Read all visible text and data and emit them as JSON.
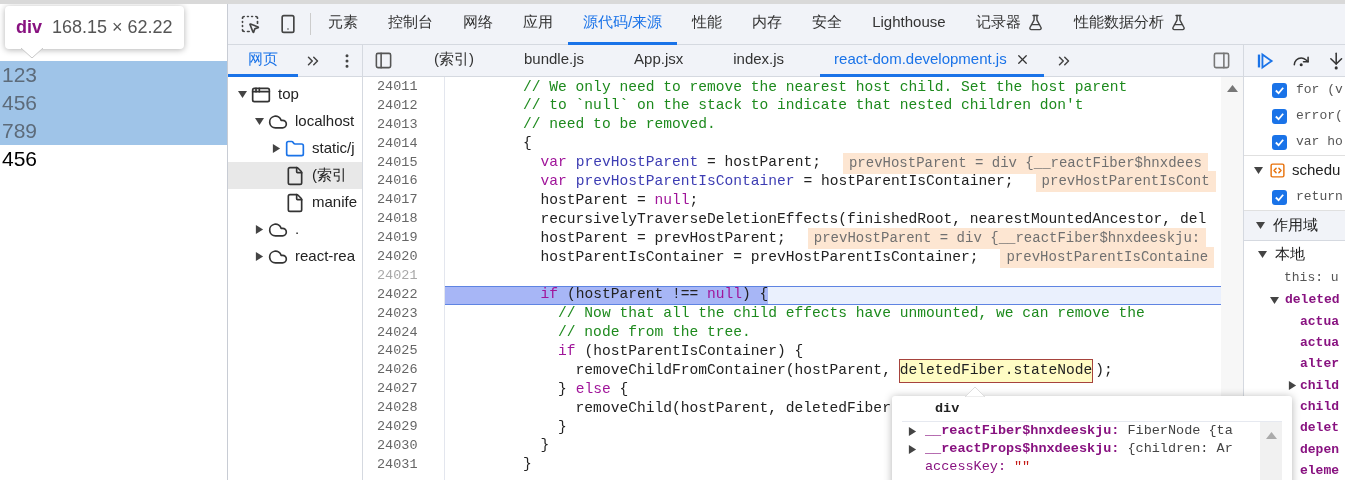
{
  "page": {
    "tooltip": {
      "tag": "div",
      "size": "168.15 × 62.22"
    },
    "lines": [
      {
        "text": "123",
        "highlighted": true
      },
      {
        "text": "456",
        "highlighted": true
      },
      {
        "text": "789",
        "highlighted": true
      },
      {
        "text": "456",
        "highlighted": false
      }
    ]
  },
  "devtools": {
    "tabs": [
      {
        "label": "元素",
        "selected": false,
        "experimental": false
      },
      {
        "label": "控制台",
        "selected": false,
        "experimental": false
      },
      {
        "label": "网络",
        "selected": false,
        "experimental": false
      },
      {
        "label": "应用",
        "selected": false,
        "experimental": false
      },
      {
        "label": "源代码/来源",
        "selected": true,
        "experimental": false
      },
      {
        "label": "性能",
        "selected": false,
        "experimental": false
      },
      {
        "label": "内存",
        "selected": false,
        "experimental": false
      },
      {
        "label": "安全",
        "selected": false,
        "experimental": false
      },
      {
        "label": "Lighthouse",
        "selected": false,
        "experimental": false
      },
      {
        "label": "记录器",
        "selected": false,
        "experimental": true
      },
      {
        "label": "性能数据分析",
        "selected": false,
        "experimental": true
      }
    ]
  },
  "navigator": {
    "tabs": [
      {
        "label": "网页",
        "selected": true
      }
    ],
    "tree": [
      {
        "kind": "frame",
        "label": "top",
        "expanded": true,
        "selected": false,
        "children": [
          {
            "kind": "domain",
            "label": "localhost",
            "expanded": true,
            "selected": false,
            "children": [
              {
                "kind": "folder",
                "label": "static/j",
                "expanded": false,
                "selected": false
              },
              {
                "kind": "file",
                "label": "(索引",
                "selected": true
              },
              {
                "kind": "file",
                "label": "manife",
                "selected": false
              }
            ]
          },
          {
            "kind": "domain",
            "label": ".",
            "expanded": false,
            "selected": false
          },
          {
            "kind": "domain",
            "label": "react-rea",
            "expanded": false,
            "selected": false
          }
        ]
      }
    ]
  },
  "editor": {
    "tabs": [
      {
        "label": "(索引)",
        "selected": false
      },
      {
        "label": "bundle.js",
        "selected": false
      },
      {
        "label": "App.jsx",
        "selected": false
      },
      {
        "label": "index.js",
        "selected": false
      },
      {
        "label": "react-dom.development.js",
        "selected": true
      }
    ],
    "lines": [
      {
        "number": "24011",
        "dimmed": false,
        "current": false,
        "segments": [
          {
            "kind": "comment",
            "text": "        // We only need to remove the nearest host child. Set the host parent"
          }
        ]
      },
      {
        "number": "24012",
        "dimmed": false,
        "current": false,
        "segments": [
          {
            "kind": "comment",
            "text": "        // to `null` on the stack to indicate that nested children don't"
          }
        ]
      },
      {
        "number": "24013",
        "dimmed": false,
        "current": false,
        "segments": [
          {
            "kind": "comment",
            "text": "        // need to be removed."
          }
        ]
      },
      {
        "number": "24014",
        "dimmed": false,
        "current": false,
        "segments": [
          {
            "kind": "plain",
            "text": "        {"
          }
        ]
      },
      {
        "number": "24015",
        "dimmed": false,
        "current": false,
        "segments": [
          {
            "kind": "keyword",
            "text": "          var"
          },
          {
            "kind": "def",
            "text": "prevHostParent"
          },
          {
            "kind": "plain",
            "text": "= hostParent;"
          },
          {
            "kind": "value",
            "text": "prevHostParent = div {__reactFiber$hnxdees"
          }
        ]
      },
      {
        "number": "24016",
        "dimmed": false,
        "current": false,
        "segments": [
          {
            "kind": "keyword",
            "text": "          var"
          },
          {
            "kind": "def",
            "text": "prevHostParentIsContainer"
          },
          {
            "kind": "plain",
            "text": "= hostParentIsContainer;"
          },
          {
            "kind": "value",
            "text": "prevHostParentIsCont"
          }
        ]
      },
      {
        "number": "24017",
        "dimmed": false,
        "current": false,
        "segments": [
          {
            "kind": "plain",
            "text": "          hostParent ="
          },
          {
            "kind": "keyword",
            "text": "null"
          },
          {
            "kind": "plain",
            "text": ";"
          }
        ]
      },
      {
        "number": "24018",
        "dimmed": false,
        "current": false,
        "segments": [
          {
            "kind": "plain",
            "text": "          recursivelyTraverseDeletionEffects(finishedRoot, nearestMountedAncestor, del"
          }
        ]
      },
      {
        "number": "24019",
        "dimmed": false,
        "current": false,
        "segments": [
          {
            "kind": "plain",
            "text": "          hostParent = prevHostParent;"
          },
          {
            "kind": "value",
            "text": "prevHostParent = div {__reactFiber$hnxdeeskju:"
          }
        ]
      },
      {
        "number": "24020",
        "dimmed": false,
        "current": false,
        "segments": [
          {
            "kind": "plain",
            "text": "          hostParentIsContainer = prevHostParentIsContainer;"
          },
          {
            "kind": "value",
            "text": "prevHostParentIsContaine"
          }
        ]
      },
      {
        "number": "24021",
        "dimmed": true,
        "current": false
      },
      {
        "number": "24022",
        "dimmed": false,
        "current": true,
        "segments": [
          {
            "kind": "keyword",
            "text": "          if"
          },
          {
            "kind": "plain",
            "text": "(hostParent !=="
          },
          {
            "kind": "keyword",
            "text": "null"
          },
          {
            "kind": "plain",
            "text": ") {"
          }
        ]
      },
      {
        "number": "24023",
        "dimmed": false,
        "current": false,
        "segments": [
          {
            "kind": "comment",
            "text": "            // Now that all the child effects have unmounted, we can remove the"
          }
        ]
      },
      {
        "number": "24024",
        "dimmed": false,
        "current": false,
        "segments": [
          {
            "kind": "comment",
            "text": "            // node from the tree."
          }
        ]
      },
      {
        "number": "24025",
        "dimmed": false,
        "current": false,
        "segments": [
          {
            "kind": "keyword",
            "text": "            if"
          },
          {
            "kind": "plain",
            "text": "(hostParentIsContainer) {"
          }
        ]
      },
      {
        "number": "24026",
        "dimmed": false,
        "current": false,
        "segments": [
          {
            "kind": "plain",
            "text": "              removeChildFromContainer(hostParent,"
          },
          {
            "kind": "evaluated",
            "text": "deletedFiber.stateNode"
          },
          {
            "kind": "plain",
            "text": ");"
          }
        ]
      },
      {
        "number": "24027",
        "dimmed": false,
        "current": false,
        "segments": [
          {
            "kind": "plain",
            "text": "            }"
          },
          {
            "kind": "keyword",
            "text": "else"
          },
          {
            "kind": "plain",
            "text": "{"
          }
        ]
      },
      {
        "number": "24028",
        "dimmed": false,
        "current": false,
        "segments": [
          {
            "kind": "plain",
            "text": "              removeChild(hostParent, deletedFiber"
          }
        ]
      },
      {
        "number": "24029",
        "dimmed": false,
        "current": false,
        "segments": [
          {
            "kind": "plain",
            "text": "            }"
          }
        ]
      },
      {
        "number": "24030",
        "dimmed": false,
        "current": false,
        "segments": [
          {
            "kind": "plain",
            "text": "          }"
          }
        ]
      },
      {
        "number": "24031",
        "dimmed": false,
        "current": false,
        "segments": [
          {
            "kind": "plain",
            "text": "        }"
          }
        ]
      }
    ],
    "popover": {
      "title": "div",
      "rows": [
        {
          "kind": "object",
          "expanded": false,
          "key": "__reactFiber$hnxdeeskju:",
          "value": "FiberNode {ta"
        },
        {
          "kind": "object",
          "expanded": false,
          "key": "__reactProps$hnxdeeskju:",
          "value": "{children: Ar"
        },
        {
          "kind": "property",
          "key": "accessKey:",
          "value": "\"\""
        }
      ]
    }
  },
  "debugger": {
    "breakpoint_groups": [
      {
        "breakpoints": [
          {
            "checked": true,
            "code": "for (v"
          },
          {
            "checked": true,
            "code": "error("
          },
          {
            "checked": true,
            "code": "var ho"
          }
        ]
      },
      {
        "file": "schedu",
        "expanded": true,
        "breakpoints": [
          {
            "checked": true,
            "code": "return"
          }
        ]
      }
    ],
    "scope": {
      "title": "作用域",
      "expanded": true,
      "groups": [
        {
          "title": "本地",
          "expanded": true,
          "items": [
            {
              "kind": "value",
              "text": "this: u"
            },
            {
              "kind": "object",
              "text": "deleted",
              "expanded": true,
              "children": [
                {
                  "kind": "property",
                  "name": "actua"
                },
                {
                  "kind": "property",
                  "name": "actua"
                },
                {
                  "kind": "property",
                  "name": "alter"
                },
                {
                  "kind": "object",
                  "name": "child",
                  "expanded": false
                },
                {
                  "kind": "property",
                  "name": "child"
                },
                {
                  "kind": "property",
                  "name": "delet"
                },
                {
                  "kind": "property",
                  "name": "depen"
                },
                {
                  "kind": "property",
                  "name": "eleme"
                }
              ]
            }
          ]
        }
      ]
    }
  }
}
